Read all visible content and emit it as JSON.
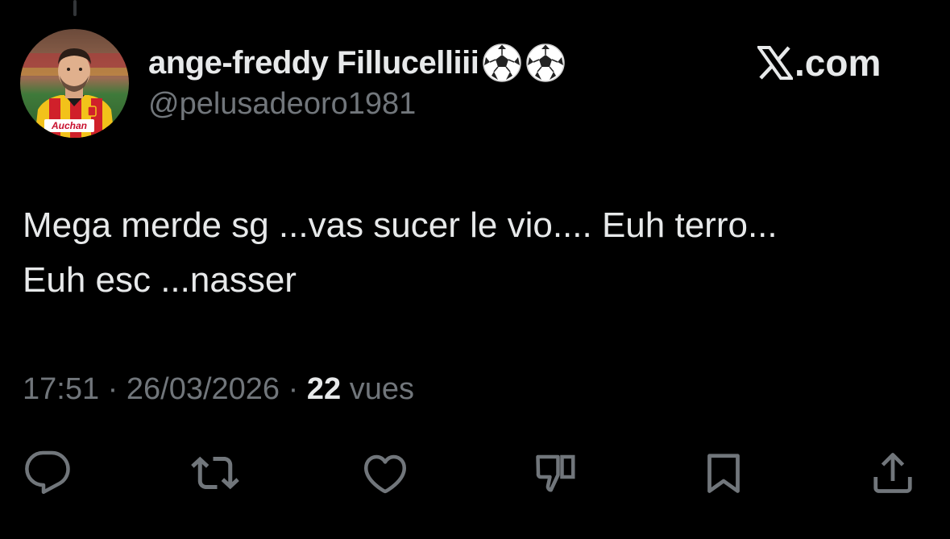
{
  "author": {
    "display_name": "ange-freddy Fillucelliii",
    "name_emojis": [
      "soccer-ball-emoji",
      "soccer-ball-emoji"
    ],
    "handle": "@pelusadeoro1981",
    "avatar_sponsor_text": "Auchan"
  },
  "brand": {
    "logo": "x-logo",
    "suffix": ".com"
  },
  "tweet": {
    "lines": [
      "Mega merde sg ...vas sucer le vio.... Euh terro...",
      "Euh esc ...nasser"
    ]
  },
  "meta": {
    "time": "17:51",
    "separator": "·",
    "date": "26/03/2026",
    "views_count": "22",
    "views_label": "vues"
  },
  "actions": [
    {
      "name": "reply",
      "icon": "reply-icon"
    },
    {
      "name": "repost",
      "icon": "repost-icon"
    },
    {
      "name": "like",
      "icon": "heart-icon"
    },
    {
      "name": "dislike",
      "icon": "thumbs-down-icon"
    },
    {
      "name": "bookmark",
      "icon": "bookmark-icon"
    },
    {
      "name": "share",
      "icon": "share-icon"
    }
  ],
  "colors": {
    "background": "#000000",
    "primary_text": "#e7e9ea",
    "secondary_text": "#71767b"
  }
}
